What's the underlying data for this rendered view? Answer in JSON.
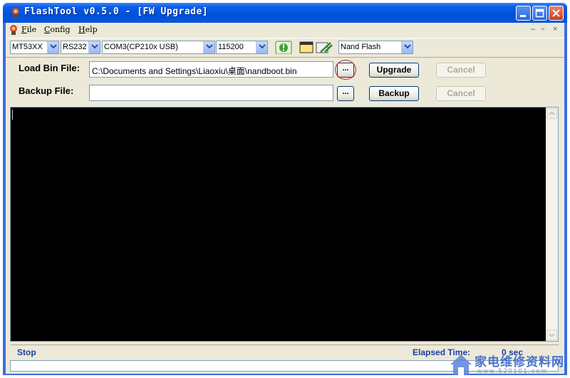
{
  "window": {
    "title": "FlashTool v0.5.0 - [FW Upgrade]"
  },
  "menu": {
    "file": "File",
    "config": "Config",
    "help": "Help"
  },
  "toolbar": {
    "chip": "MT53XX",
    "interface": "RS232",
    "port": "COM3(CP210x USB)",
    "baud": "115200",
    "flash_type": "Nand Flash"
  },
  "form": {
    "load_label": "Load Bin File:",
    "load_value": "C:\\Documents and Settings\\Liaoxiu\\桌面\\nandboot.bin",
    "backup_label": "Backup File:",
    "backup_value": "",
    "browse_label": "...",
    "upgrade_label": "Upgrade",
    "backup_button": "Backup",
    "cancel_label": "Cancel"
  },
  "status": {
    "state": "Stop",
    "elapsed_label": "Elapsed Time:",
    "elapsed_value": "0 sec"
  },
  "watermark": {
    "text": "家电维修资料网",
    "sub": "www.520101.com"
  },
  "colors": {
    "title_bar": "#0a5fea",
    "console_bg": "#000000",
    "status_text": "#1a3ea8",
    "highlight_circle": "#d42020"
  }
}
